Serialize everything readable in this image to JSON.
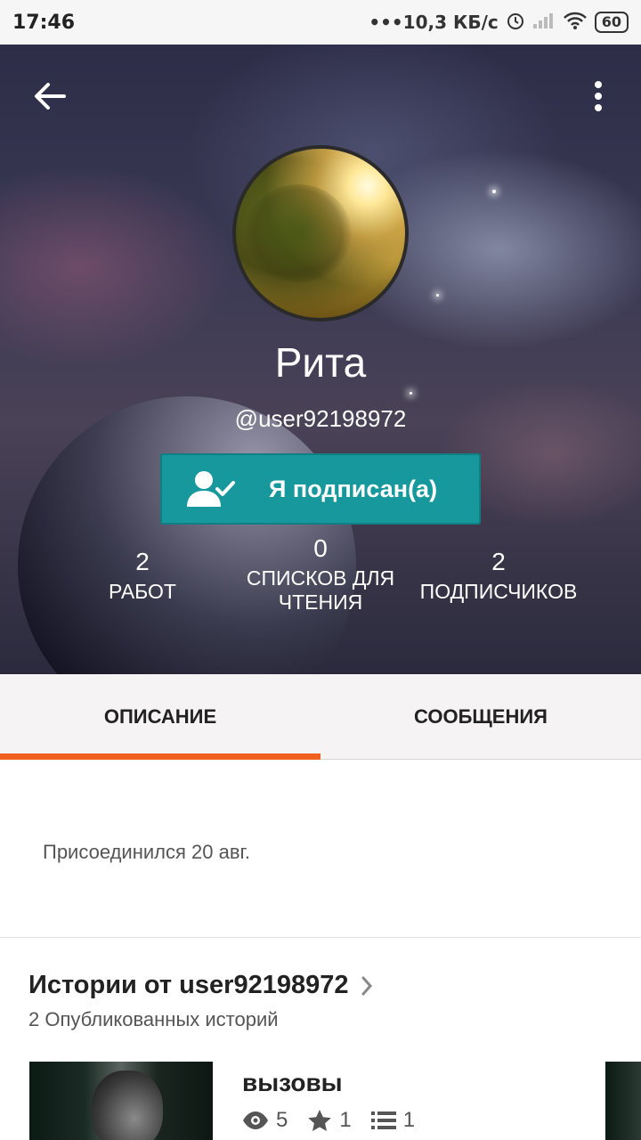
{
  "status_bar": {
    "time": "17:46",
    "network_speed": "10,3 КБ/с",
    "battery": "60"
  },
  "profile": {
    "name": "Рита",
    "handle": "@user92198972",
    "follow_button_label": "Я подписан(а)",
    "stats": [
      {
        "value": "2",
        "label": "РАБОТ"
      },
      {
        "value": "0",
        "label": "СПИСКОВ ДЛЯ ЧТЕНИЯ"
      },
      {
        "value": "2",
        "label": "ПОДПИСЧИКОВ"
      }
    ]
  },
  "tabs": [
    {
      "label": "ОПИСАНИЕ",
      "active": true
    },
    {
      "label": "СООБЩЕНИЯ",
      "active": false
    }
  ],
  "description": {
    "joined": "Присоединился 20 авг."
  },
  "stories": {
    "title": "Истории от user92198972",
    "count_label": "2 Опубликованных историй",
    "items": [
      {
        "title": "вызовы",
        "views": "5",
        "votes": "1",
        "parts": "1"
      }
    ]
  },
  "colors": {
    "accent": "#f0601e",
    "follow_button": "#17989c"
  }
}
